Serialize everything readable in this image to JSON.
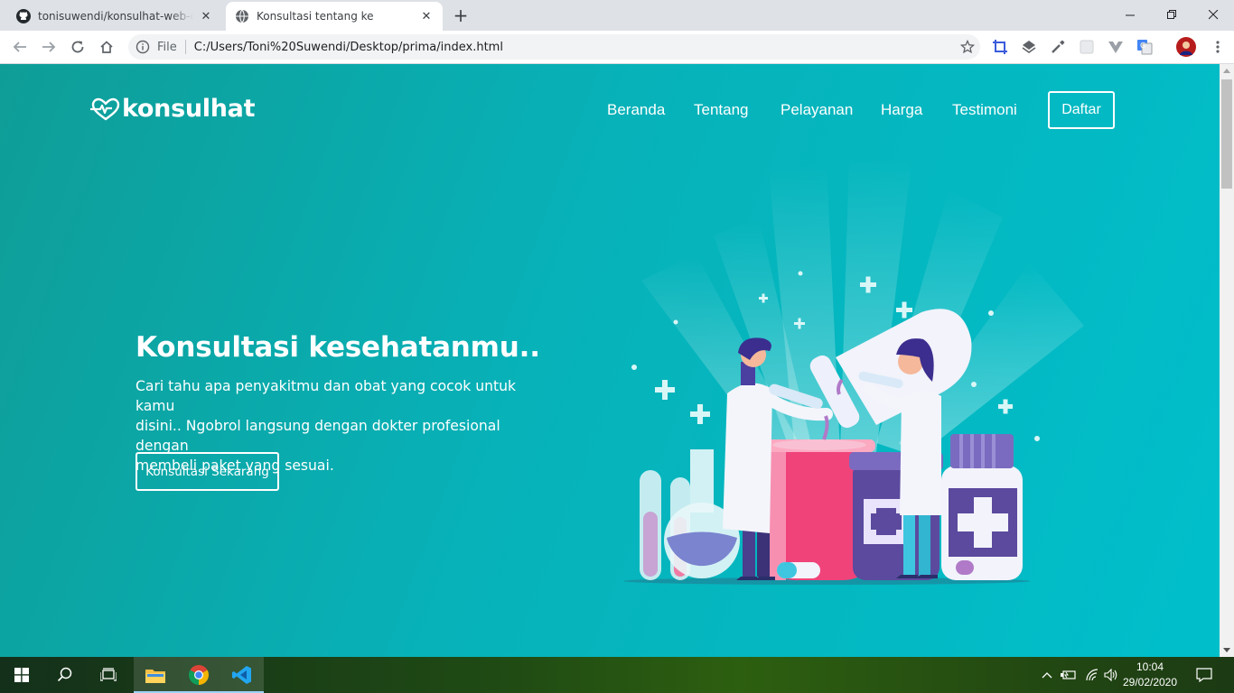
{
  "browser": {
    "tabs": [
      {
        "title": "tonisuwendi/konsulhat-web-desi",
        "icon": "github-icon",
        "active": false
      },
      {
        "title": "Konsultasi tentang ke",
        "icon": "globe-icon",
        "active": true
      }
    ],
    "address": {
      "scheme_label": "File",
      "url": "C:/Users/Toni%20Suwendi/Desktop/prima/index.html"
    }
  },
  "page": {
    "brand": "konsulhat",
    "nav": [
      "Beranda",
      "Tentang",
      "Pelayanan",
      "Harga",
      "Testimoni"
    ],
    "register_label": "Daftar",
    "hero": {
      "title": "Konsultasi kesehatanmu..",
      "text_lines": [
        "Cari tahu apa penyakitmu dan obat yang cocok untuk kamu",
        "disini.. Ngobrol langsung dengan dokter profesional dengan",
        "membeli paket yang sesuai."
      ],
      "cta_label": "Konsultasi Sekarang"
    },
    "colors": {
      "bg_start": "#0f9d97",
      "bg_end": "#00bfcb",
      "accent_pink": "#f0437a",
      "accent_purple": "#5b4a9e"
    }
  },
  "taskbar": {
    "apps": [
      "start-icon",
      "search-icon",
      "task-view-icon",
      "file-explorer-icon",
      "chrome-icon",
      "vscode-icon"
    ],
    "clock": {
      "time": "10:04",
      "date": "29/02/2020"
    }
  }
}
